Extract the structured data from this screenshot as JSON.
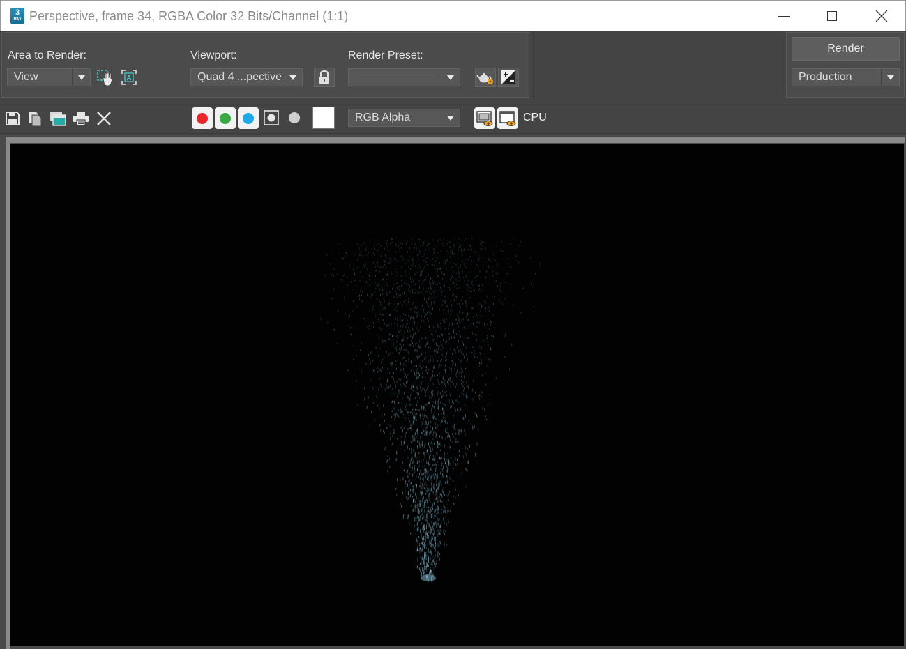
{
  "window": {
    "app_icon_text": "3",
    "app_icon_subtext": "MAX",
    "title": "Perspective, frame 34, RGBA Color 32 Bits/Channel (1:1)"
  },
  "settings": {
    "area_label": "Area to Render:",
    "area_value": "View",
    "viewport_label": "Viewport:",
    "viewport_value": "Quad 4 ...pective",
    "preset_label": "Render Preset:",
    "preset_value": "",
    "render_label": "Render",
    "mode_value": "Production"
  },
  "toolbar": {
    "channel_display": "RGB Alpha",
    "renderer_label": "CPU"
  },
  "colors": {
    "red_channel": "#e8262b",
    "green_channel": "#3aa843",
    "blue_channel": "#1ea8e6",
    "particle": "#7fb3c8"
  }
}
